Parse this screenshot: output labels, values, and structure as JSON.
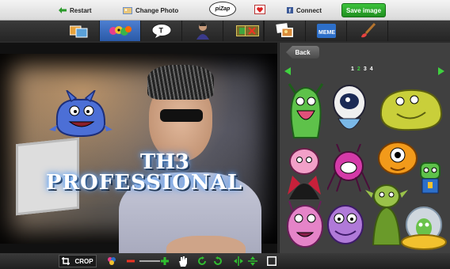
{
  "topbar": {
    "restart_label": "Restart",
    "change_photo_label": "Change Photo",
    "logo_text": "piZap",
    "connect_label": "Connect",
    "save_label": "Save image"
  },
  "toolbar": {
    "tools": [
      {
        "name": "effects",
        "icon": "effects-icon"
      },
      {
        "name": "stickers",
        "icon": "stickers-icon"
      },
      {
        "name": "text",
        "icon": "text-bubble-icon",
        "label": "T"
      },
      {
        "name": "cutout",
        "icon": "cutout-icon"
      },
      {
        "name": "borders",
        "icon": "border-icon"
      },
      {
        "name": "remove",
        "icon": "remove-border-icon"
      },
      {
        "name": "photos",
        "icon": "add-photo-icon"
      },
      {
        "name": "meme",
        "icon": "meme-icon",
        "label": "MEME"
      },
      {
        "name": "paint",
        "icon": "paint-brush-icon"
      }
    ],
    "active_tool": "stickers"
  },
  "canvas": {
    "text_line1": "TH3",
    "text_line2": "PROFESSIONAL"
  },
  "bottombar": {
    "crop_label": "CROP",
    "icons": [
      "crop-icon",
      "filter-icon",
      "zoom-out-icon",
      "zoom-slider",
      "zoom-in-icon",
      "pan-hand-icon",
      "rotate-left-icon",
      "rotate-right-icon",
      "flip-horizontal-icon",
      "flip-vertical-icon",
      "fit-icon"
    ]
  },
  "panel": {
    "back_label": "Back",
    "pages": [
      "1",
      "2",
      "3",
      "4"
    ],
    "current_page": "2",
    "stickers": [
      "green-monster",
      "white-alien",
      "yellow-blob",
      "pink-vampire",
      "purple-spider",
      "orange-blob",
      "green-robot",
      "pink-monster",
      "purple-monster",
      "green-troll",
      "alien-ufo"
    ]
  },
  "colors": {
    "accent_green": "#2ab52a",
    "active_tool_blue": "#2a5aa8",
    "toolbar_dark": "#2b2b2b",
    "panel_bg": "#404040"
  }
}
